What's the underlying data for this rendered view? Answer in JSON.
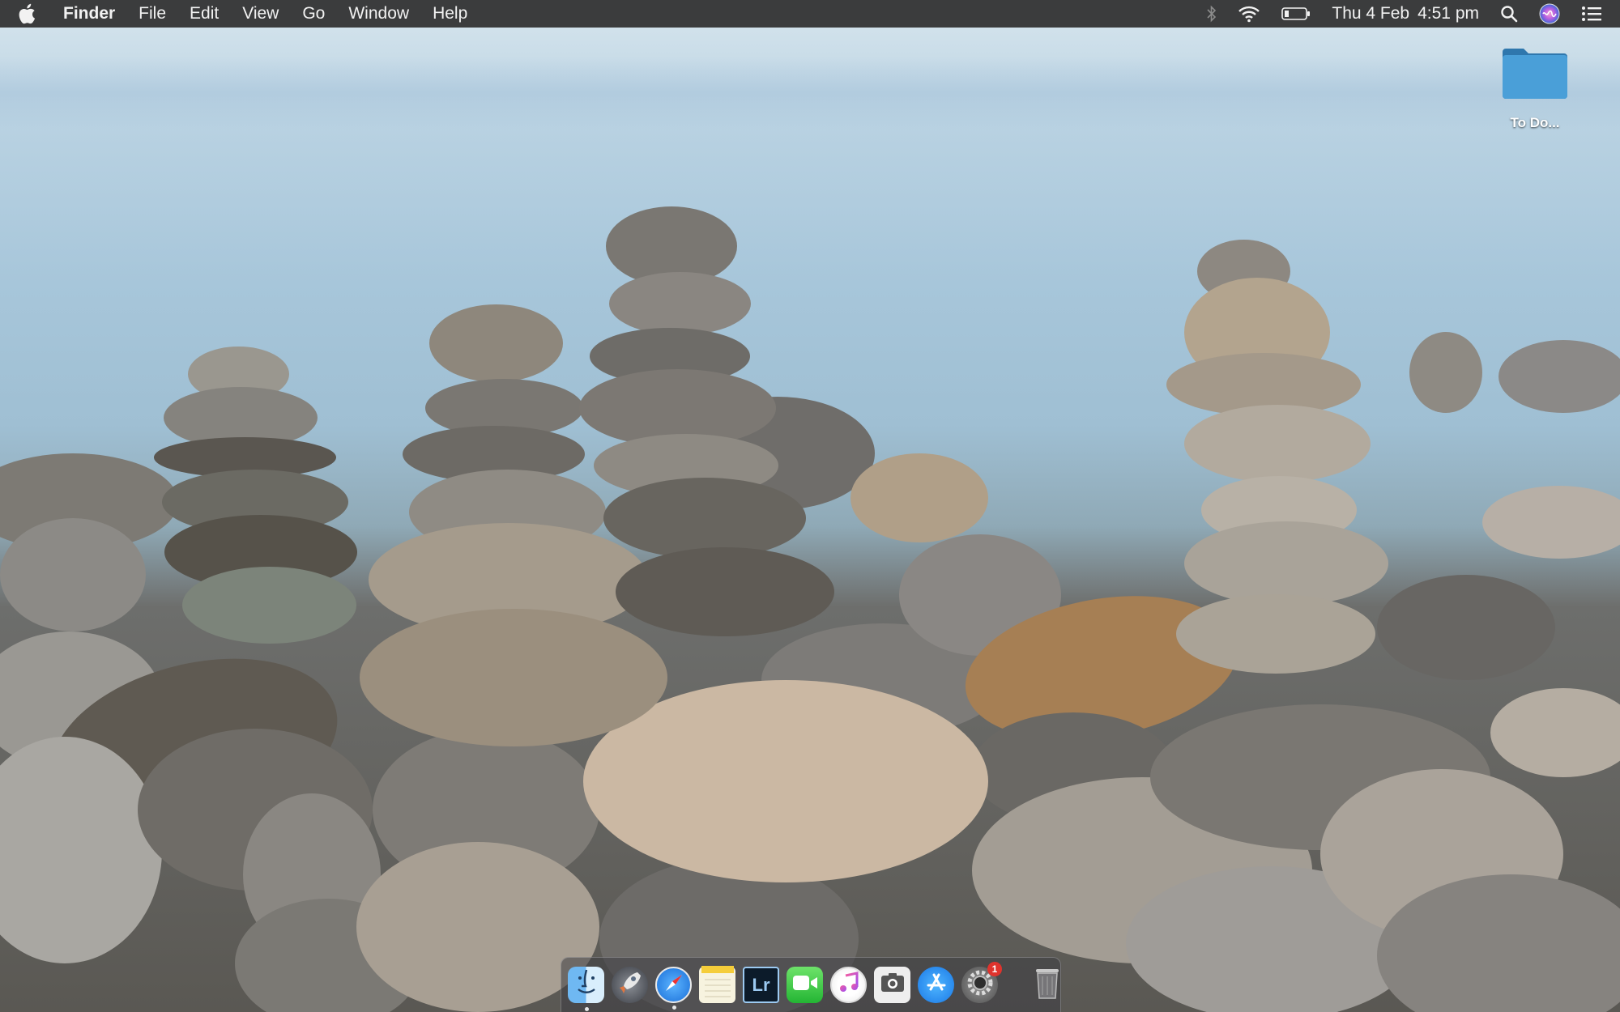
{
  "menubar": {
    "app_name": "Finder",
    "menus": [
      "File",
      "Edit",
      "View",
      "Go",
      "Window",
      "Help"
    ],
    "date": "Thu 4 Feb",
    "time": "4:51 pm"
  },
  "desktop": {
    "items": [
      {
        "label": "To Do..."
      }
    ]
  },
  "dock": {
    "items": [
      {
        "name": "Finder",
        "icon": "finder-icon",
        "running": true
      },
      {
        "name": "Launchpad",
        "icon": "launchpad-icon",
        "running": false
      },
      {
        "name": "Safari",
        "icon": "safari-icon",
        "running": true
      },
      {
        "name": "Notes",
        "icon": "notes-icon",
        "running": false
      },
      {
        "name": "Lightroom",
        "icon": "lightroom-icon",
        "label": "Lr",
        "running": false
      },
      {
        "name": "FaceTime",
        "icon": "facetime-icon",
        "running": false
      },
      {
        "name": "iTunes",
        "icon": "itunes-icon",
        "running": false
      },
      {
        "name": "Screenshot",
        "icon": "screenshot-icon",
        "running": false
      },
      {
        "name": "App Store",
        "icon": "app-store-icon",
        "running": false
      },
      {
        "name": "System Preferences",
        "icon": "system-preferences-icon",
        "badge": "1",
        "running": false
      },
      {
        "name": "Trash",
        "icon": "trash-icon",
        "running": false
      }
    ]
  },
  "colors": {
    "menubar_bg": "#3b3c3d",
    "folder_blue": "#3f8fc4",
    "badge_red": "#e0332d"
  }
}
